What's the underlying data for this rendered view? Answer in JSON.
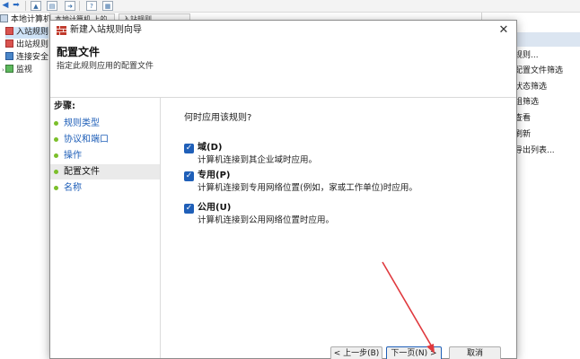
{
  "background": {
    "toolbar": {
      "icons": [
        "back-arrow-icon",
        "forward-arrow-icon",
        "up-folder-icon",
        "show-tree-icon",
        "export-icon",
        "help-icon",
        "properties-icon"
      ]
    },
    "tree": {
      "items": [
        {
          "label": "本地计算机 上的高级安全 Wi",
          "icon": "computer-icon"
        },
        {
          "label": "入站规则",
          "icon": "inbound-rules-icon"
        },
        {
          "label": "出站规则",
          "icon": "outbound-rules-icon"
        },
        {
          "label": "连接安全",
          "icon": "connection-security-icon"
        },
        {
          "label": "监视",
          "icon": "monitor-icon"
        }
      ]
    },
    "tabs": [
      "本地计算机 上的高级安全 Wi",
      "入站规则"
    ],
    "actions": {
      "items": [
        "规则...",
        "配置文件筛选",
        "状态筛选",
        "组筛选",
        "查看",
        "刷新",
        "导出列表..."
      ]
    }
  },
  "dialog": {
    "title": "新建入站规则向导",
    "heading": "配置文件",
    "subheading": "指定此规则应用的配置文件",
    "close_icon": "close-icon",
    "steps_title": "步骤:",
    "steps": [
      {
        "label": "规则类型",
        "active": false
      },
      {
        "label": "协议和端口",
        "active": false
      },
      {
        "label": "操作",
        "active": false
      },
      {
        "label": "配置文件",
        "active": true
      },
      {
        "label": "名称",
        "active": false
      }
    ],
    "question": "何时应用该规则?",
    "options": [
      {
        "label": "域(D)",
        "description": "计算机连接到其企业域时应用。",
        "checked": true
      },
      {
        "label": "专用(P)",
        "description": "计算机连接到专用网络位置(例如，家或工作单位)时应用。",
        "checked": true
      },
      {
        "label": "公用(U)",
        "description": "计算机连接到公用网络位置时应用。",
        "checked": true
      }
    ],
    "buttons": {
      "back": "< 上一步(B)",
      "next": "下一页(N) >",
      "cancel": "取消"
    }
  },
  "colors": {
    "accent": "#1f5fb8",
    "step_dot": "#7bbf2a",
    "annotation_arrow": "#e0393e"
  }
}
